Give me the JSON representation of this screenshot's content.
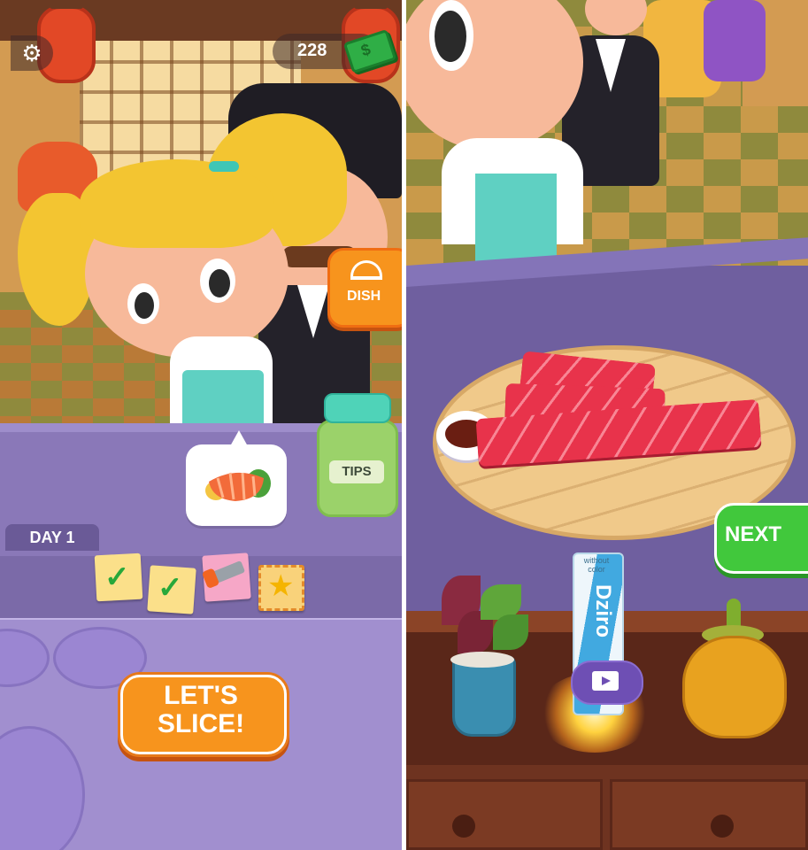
{
  "hud": {
    "settings_icon": "gear-icon",
    "money": "228",
    "money_icon": "cash-stack-icon"
  },
  "kitchen": {
    "dish_button": "DISH",
    "order_icon": "salmon-sashimi-icon",
    "tips_jar": "TIPS",
    "day_label": "DAY 1",
    "tasks": [
      {
        "icon": "checkmark-icon",
        "status": "done"
      },
      {
        "icon": "checkmark-icon",
        "status": "done"
      },
      {
        "icon": "chainsaw-icon",
        "status": "pending"
      },
      {
        "icon": "star-icon",
        "status": "pending"
      }
    ],
    "slice_button_line1": "LET'S",
    "slice_button_line2": "SLICE!"
  },
  "plating": {
    "next_button": "NEXT",
    "wasabi_tube_small_text": "without color",
    "wasabi_tube_brand": "Dziro",
    "video_ad_icon": "video-clapper-icon"
  },
  "colors": {
    "orange_button": "#f7941d",
    "green_button": "#41c83c",
    "counter_purple": "#8a78b8",
    "tuna_red": "#e8334b"
  }
}
